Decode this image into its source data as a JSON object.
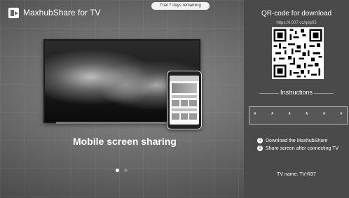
{
  "header": {
    "app_title": "MaxhubShare for TV",
    "trial_text": "Trial 7 days remaining"
  },
  "slide": {
    "title": "Mobile screen sharing",
    "page_count": 2,
    "active_page": 1
  },
  "right_panel": {
    "qr_heading": "QR-code for download",
    "qr_url": "https://t.007.cc/qdp05",
    "instructions_label": "Instructions",
    "pin_chars": [
      "*",
      "*",
      "*",
      "*",
      "*",
      "*"
    ],
    "steps": [
      {
        "num": "1",
        "text": "Download the MaxhubShare"
      },
      {
        "num": "2",
        "text": "Share screen after connecting TV"
      }
    ],
    "tv_name": "TV name: TV-R37"
  },
  "colors": {
    "panel_bg": "#4a4a4a",
    "accent_text": "#ffffff"
  }
}
